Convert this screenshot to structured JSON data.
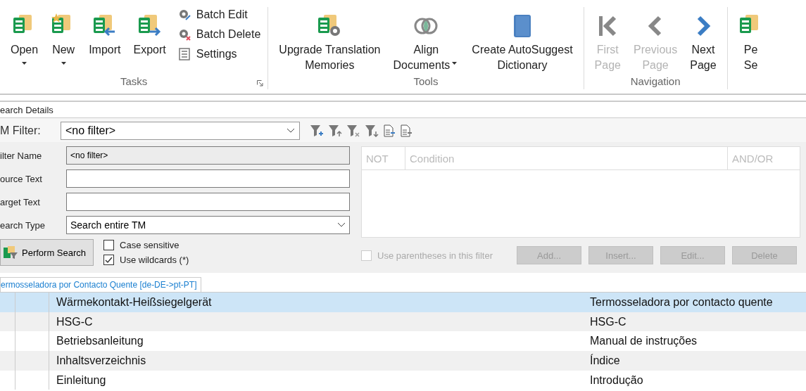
{
  "ribbon": {
    "groups": [
      {
        "label": "Tasks",
        "launcher": true,
        "buttons": [
          {
            "kind": "open",
            "lines": [
              "Open"
            ],
            "dropdown": true,
            "disabled": false
          },
          {
            "kind": "new",
            "lines": [
              "New"
            ],
            "dropdown": true,
            "disabled": false
          },
          {
            "kind": "import",
            "lines": [
              "Import"
            ],
            "dropdown": false,
            "disabled": false
          },
          {
            "kind": "export",
            "lines": [
              "Export"
            ],
            "dropdown": false,
            "disabled": false
          }
        ],
        "small_buttons": [
          {
            "kind": "batch-edit",
            "label": "Batch Edit"
          },
          {
            "kind": "batch-delete",
            "label": "Batch Delete"
          },
          {
            "kind": "settings",
            "label": "Settings"
          }
        ]
      },
      {
        "label": "Tools",
        "buttons": [
          {
            "kind": "upgrade",
            "lines": [
              "Upgrade Translation",
              "Memories"
            ],
            "dropdown": false,
            "disabled": false
          },
          {
            "kind": "align",
            "lines": [
              "Align",
              "Documents"
            ],
            "dropdown": true,
            "disabled": false
          },
          {
            "kind": "dictionary",
            "lines": [
              "Create AutoSuggest",
              "Dictionary"
            ],
            "dropdown": false,
            "disabled": false
          }
        ]
      },
      {
        "label": "Navigation",
        "buttons": [
          {
            "kind": "first",
            "lines": [
              "First",
              "Page"
            ],
            "dropdown": false,
            "disabled": true
          },
          {
            "kind": "previous",
            "lines": [
              "Previous",
              "Page"
            ],
            "dropdown": false,
            "disabled": true
          },
          {
            "kind": "next",
            "lines": [
              "Next",
              "Page"
            ],
            "dropdown": false,
            "disabled": false
          }
        ]
      },
      {
        "buttons": [
          {
            "kind": "open",
            "lines": [
              "Pe",
              "Se"
            ],
            "dropdown": false,
            "disabled": false
          }
        ]
      }
    ]
  },
  "search_panel": {
    "title": "earch Details",
    "tm_filter": {
      "label": "M Filter:",
      "value": "<no filter>"
    },
    "fields": [
      {
        "label": "ilter Name",
        "kind": "readonly",
        "value": "<no filter>"
      },
      {
        "label": "ource Text",
        "kind": "text"
      },
      {
        "label": "arget Text",
        "kind": "text"
      },
      {
        "label": "earch Type",
        "kind": "select",
        "value": "Search entire TM"
      }
    ],
    "perform_button": "Perform Search",
    "options": [
      {
        "label": "Case sensitive",
        "checked": false
      },
      {
        "label": "Use wildcards (*)",
        "checked": true
      }
    ],
    "conditions": {
      "columns": [
        "NOT",
        "Condition",
        "AND/OR"
      ]
    },
    "parentheses": {
      "label": "Use parentheses in this filter",
      "checked": false,
      "disabled": true
    },
    "condition_buttons": [
      {
        "label": "Add...",
        "disabled": true
      },
      {
        "label": "Insert...",
        "disabled": true
      },
      {
        "label": "Edit...",
        "disabled": true
      },
      {
        "label": "Delete",
        "disabled": true
      }
    ]
  },
  "document_tab": {
    "label": "ermosseladora por Contacto Quente [de-DE->pt-PT]",
    "selected": true
  },
  "table": {
    "rows": [
      {
        "source": "Wärmekontakt-Heißsiegelgerät",
        "target": "Termosseladora por contacto quente",
        "selected": true
      },
      {
        "source": "HSG-C",
        "target": "HSG-C",
        "selected": false
      },
      {
        "source": "Betriebsanleitung",
        "target": "Manual de instruções",
        "selected": false
      },
      {
        "source": "Inhaltsverzeichnis",
        "target": "Índice",
        "selected": false
      },
      {
        "source": "Einleitung",
        "target": "Introdução",
        "selected": false
      }
    ]
  }
}
